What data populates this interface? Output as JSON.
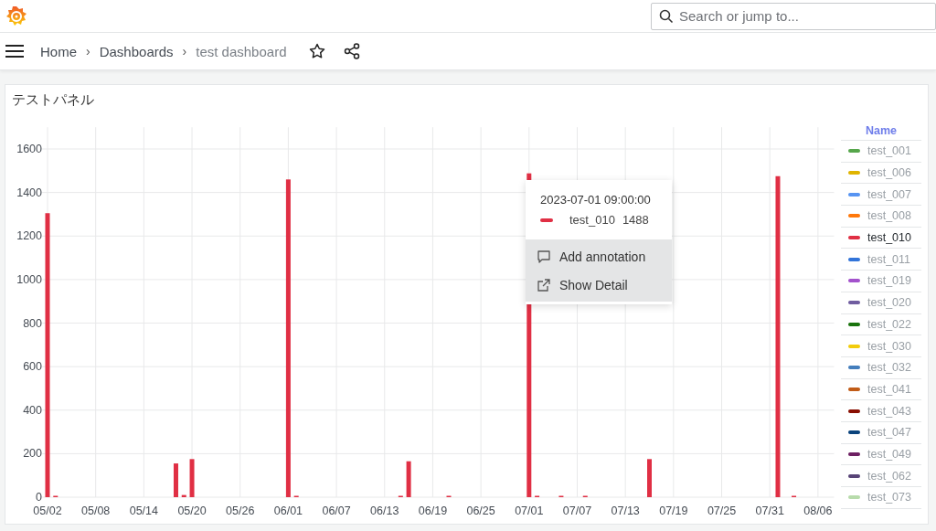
{
  "top_bar": {
    "search": {
      "placeholder": "Search or jump to..."
    }
  },
  "breadcrumbs": [
    {
      "label": "Home",
      "current": false
    },
    {
      "separator": "›",
      "label": "Dashboards",
      "current": false
    },
    {
      "separator": "›",
      "label": "test dashboard",
      "current": true
    }
  ],
  "panel": {
    "title": "テストパネル",
    "chart_data": {
      "type": "bar",
      "categories": [
        "05/02",
        null,
        null,
        null,
        null,
        null,
        "05/08",
        null,
        null,
        null,
        null,
        null,
        "05/14",
        null,
        null,
        null,
        null,
        null,
        "05/20",
        null,
        null,
        null,
        null,
        null,
        "05/26",
        null,
        null,
        null,
        null,
        null,
        "06/01",
        null,
        null,
        null,
        null,
        null,
        "06/07",
        null,
        null,
        null,
        null,
        null,
        "06/13",
        null,
        null,
        null,
        null,
        null,
        "06/19",
        null,
        null,
        null,
        null,
        null,
        "06/25",
        null,
        null,
        null,
        null,
        null,
        "07/01",
        null,
        null,
        null,
        null,
        null,
        "07/07",
        null,
        null,
        null,
        null,
        null,
        "07/13",
        null,
        null,
        null,
        null,
        null,
        "07/19",
        null,
        null,
        null,
        null,
        null,
        "07/25",
        null,
        null,
        null,
        null,
        null,
        "07/31",
        null,
        null,
        null,
        null,
        null,
        "08/06",
        null,
        null
      ],
      "series": [
        {
          "color": "#e02f44",
          "values": [
            1305,
            5,
            null,
            null,
            null,
            null,
            null,
            null,
            null,
            null,
            null,
            null,
            null,
            null,
            null,
            null,
            155,
            10,
            175,
            null,
            null,
            null,
            null,
            null,
            null,
            null,
            null,
            null,
            null,
            null,
            1460,
            2,
            null,
            null,
            null,
            null,
            null,
            null,
            null,
            null,
            null,
            null,
            null,
            null,
            2,
            165,
            null,
            null,
            null,
            null,
            5,
            null,
            null,
            null,
            null,
            null,
            null,
            null,
            null,
            null,
            1488,
            2,
            null,
            null,
            2,
            null,
            null,
            2,
            null,
            null,
            null,
            null,
            null,
            null,
            null,
            175,
            null,
            null,
            null,
            null,
            null,
            null,
            null,
            null,
            null,
            null,
            null,
            null,
            null,
            null,
            null,
            1475,
            null,
            3,
            null,
            null,
            null,
            null,
            null
          ]
        }
      ],
      "grid": true,
      "ylim": [
        0,
        1700
      ],
      "yticks": [
        0,
        200,
        400,
        600,
        800,
        1000,
        1200,
        1400,
        1600
      ]
    },
    "legend": {
      "header": "Name",
      "items": [
        {
          "name": "test_001",
          "color": "#56a64b",
          "selected": false
        },
        {
          "name": "test_006",
          "color": "#e0b400",
          "selected": false
        },
        {
          "name": "test_007",
          "color": "#5794f2",
          "selected": false
        },
        {
          "name": "test_008",
          "color": "#ff780a",
          "selected": false
        },
        {
          "name": "test_010",
          "color": "#e02f44",
          "selected": true
        },
        {
          "name": "test_011",
          "color": "#3274d9",
          "selected": false
        },
        {
          "name": "test_019",
          "color": "#a352cc",
          "selected": false
        },
        {
          "name": "test_020",
          "color": "#705da0",
          "selected": false
        },
        {
          "name": "test_022",
          "color": "#19730e",
          "selected": false
        },
        {
          "name": "test_030",
          "color": "#f2cc0c",
          "selected": false
        },
        {
          "name": "test_032",
          "color": "#447ebc",
          "selected": false
        },
        {
          "name": "test_041",
          "color": "#c15c17",
          "selected": false
        },
        {
          "name": "test_043",
          "color": "#890f02",
          "selected": false
        },
        {
          "name": "test_047",
          "color": "#0a437c",
          "selected": false
        },
        {
          "name": "test_049",
          "color": "#6d1f62",
          "selected": false
        },
        {
          "name": "test_062",
          "color": "#584477",
          "selected": false
        },
        {
          "name": "test_073",
          "color": "#b7dbab",
          "selected": false
        }
      ]
    },
    "tooltip": {
      "time": "2023-07-01 09:00:00",
      "series": "test_010",
      "color": "#e02f44",
      "value": "1488",
      "menu": [
        {
          "kind": "annotation",
          "label": "Add annotation"
        },
        {
          "kind": "link",
          "label": "Show Detail"
        }
      ]
    }
  }
}
